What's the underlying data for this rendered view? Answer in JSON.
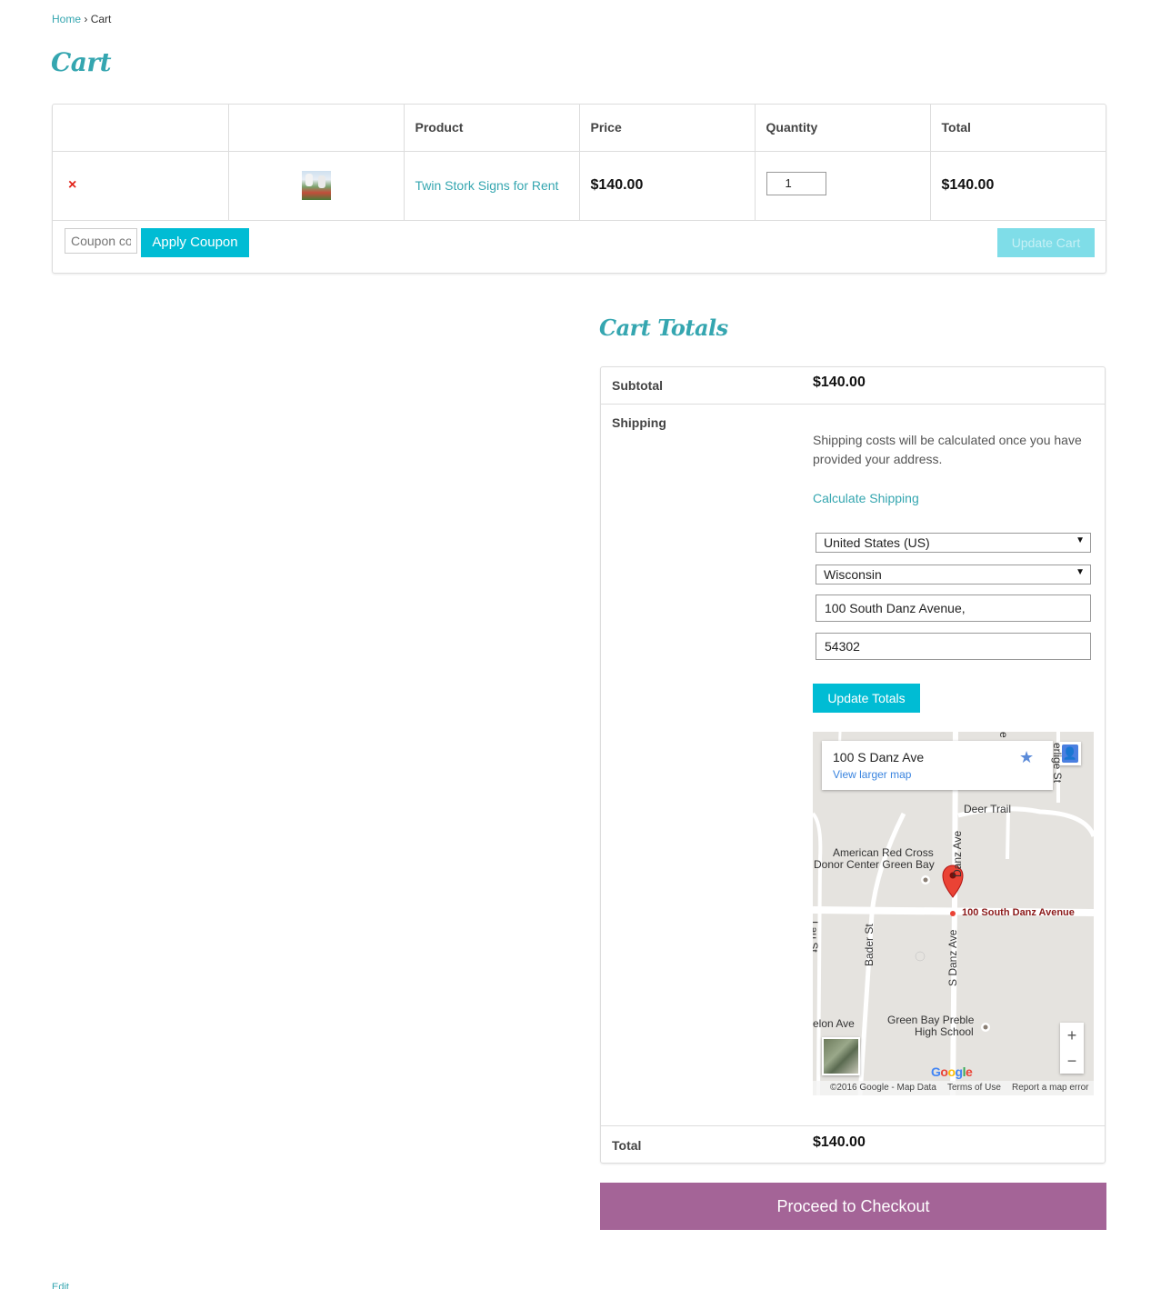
{
  "breadcrumb": {
    "home": "Home",
    "separator": "›",
    "current": "Cart"
  },
  "page_title": "Cart",
  "cart_table": {
    "headers": [
      "",
      "",
      "Product",
      "Price",
      "Quantity",
      "Total"
    ],
    "row": {
      "remove": "×",
      "product": "Twin Stork Signs for Rent",
      "price": "$140.00",
      "quantity": "1",
      "total": "$140.00"
    },
    "coupon_placeholder": "Coupon code",
    "apply_coupon": "Apply Coupon",
    "update_cart": "Update Cart"
  },
  "totals": {
    "title": "Cart Totals",
    "subtotal_label": "Subtotal",
    "subtotal_value": "$140.00",
    "shipping_label": "Shipping",
    "shipping_note": "Shipping costs will be calculated once you have provided your address.",
    "calculate_shipping": "Calculate Shipping",
    "country": "United States (US)",
    "state": "Wisconsin",
    "address": "100 South Danz Avenue,",
    "postcode": "54302",
    "update_totals": "Update Totals",
    "total_label": "Total",
    "total_value": "$140.00"
  },
  "map": {
    "card_title": "100 S Danz Ave",
    "card_link": "View larger map",
    "marker_label": "100 South Danz Avenue",
    "labels": {
      "deer_trail": "Deer Trail",
      "red_cross_1": "American Red Cross",
      "red_cross_2": "Donor Center Green Bay",
      "danz_ave": "Danz Ave",
      "s_danz_ave": "S Danz Ave",
      "bader_st": "Bader St",
      "lau_st": "Lau St",
      "elon_ave": "elon Ave",
      "school_1": "Green Bay Preble",
      "school_2": "High School",
      "verlige_st": "erlige St",
      "top_e": "e"
    },
    "zoom_in": "+",
    "zoom_out": "−",
    "google": "Google",
    "footer_copyright": "©2016 Google - Map Data",
    "footer_terms": "Terms of Use",
    "footer_report": "Report a map error",
    "colors": {
      "road": "#ffffff",
      "land": "#e5e3df",
      "marker": "#ea4335"
    }
  },
  "checkout_button": "Proceed to Checkout",
  "edit_link": "Edit",
  "colors": {
    "accent": "#35a6b0",
    "button": "#00bcd4",
    "checkout": "#a46497",
    "remove": "#e2231a"
  }
}
